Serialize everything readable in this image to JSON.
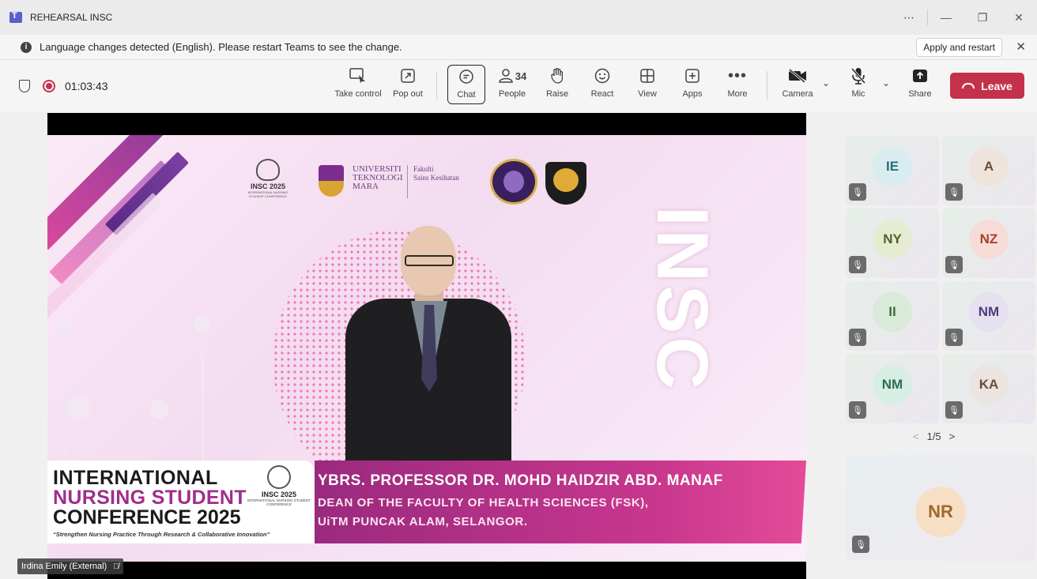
{
  "window": {
    "title": "REHEARSAL INSC",
    "controls": [
      "⋯",
      "—",
      "❐",
      "✕"
    ]
  },
  "notification": {
    "icon": "info-icon",
    "text": "Language changes detected (English). Please restart Teams to see the change.",
    "button": "Apply and restart",
    "close": "✕"
  },
  "meeting": {
    "timer": "01:03:43",
    "buttons": {
      "take_control": "Take control",
      "pop_out": "Pop out",
      "chat": "Chat",
      "people": "People",
      "people_count": "34",
      "raise": "Raise",
      "react": "React",
      "view": "View",
      "apps": "Apps",
      "more": "More",
      "camera": "Camera",
      "mic": "Mic",
      "share": "Share",
      "leave": "Leave"
    }
  },
  "slide": {
    "insc_vertical": "INSC",
    "logo_small_title": "INSC 2025",
    "logo_small_sub": "INTERNATIONAL NURSING STUDENT CONFERENCE",
    "uitm_lines": [
      "UNIVERSITI",
      "TEKNOLOGI",
      "MARA"
    ],
    "faculty_lines": [
      "Fakulti",
      "Sains Kesihatan"
    ],
    "conf_line1": "INTERNATIONAL",
    "conf_line2": "NURSING STUDENT",
    "conf_line3": "CONFERENCE 2025",
    "conf_tagline": "“Strengthen Nursing Practice Through Research & Collaborative Innovation”",
    "logo_np_title": "INSC 2025",
    "logo_np_sub": "INTERNATIONAL NURSING STUDENT CONFERENCE",
    "speaker_name": "YBRS. PROFESSOR DR. MOHD HAIDZIR ABD. MANAF",
    "speaker_role_1": "DEAN OF THE FACULTY OF HEALTH SCIENCES (FSK),",
    "speaker_role_2": "UiTM PUNCAK ALAM, SELANGOR."
  },
  "caption": {
    "name": "Irdina Emily (External)"
  },
  "participants": [
    {
      "initials": "IE",
      "bg": "#d9ecef",
      "fg": "#2b6e7a"
    },
    {
      "initials": "A",
      "bg": "#efe4dc",
      "fg": "#6e4a36"
    },
    {
      "initials": "NY",
      "bg": "#e5ecd2",
      "fg": "#4f6225"
    },
    {
      "initials": "NZ",
      "bg": "#f6dcd6",
      "fg": "#a8402c"
    },
    {
      "initials": "II",
      "bg": "#d9ead8",
      "fg": "#3f6a3a"
    },
    {
      "initials": "NM",
      "bg": "#e5e1f1",
      "fg": "#4b3f79"
    },
    {
      "initials": "NM",
      "bg": "#d6eee4",
      "fg": "#2f6b52"
    },
    {
      "initials": "KA",
      "bg": "#ebe4e0",
      "fg": "#6a4c3e"
    }
  ],
  "pager": {
    "label": "1/5"
  },
  "featured": {
    "initials": "NR"
  }
}
